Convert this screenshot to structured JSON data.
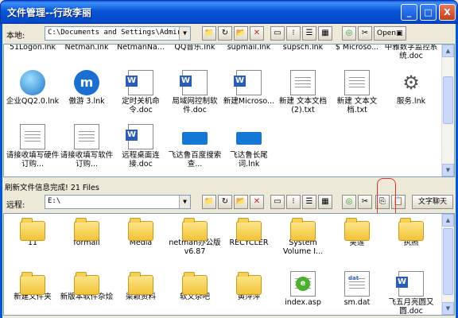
{
  "window": {
    "title": "文件管理--行政李丽",
    "min": "_",
    "max": "□",
    "close": "X"
  },
  "local": {
    "label": "本地:",
    "path": "C:\\Documents and Settings\\Admir",
    "open_label": "Open",
    "top_row": [
      "51Logon.lnk",
      "Netman.lnk",
      "NetmanNa...",
      "QQ音乐.lnk",
      "supmail.lnk",
      "supsch.lnk",
      "$ Microso...",
      "中雅数字监控系统.doc"
    ],
    "row1": [
      {
        "name": "企业QQ2.0.lnk",
        "icon": "qq-icon"
      },
      {
        "name": "傲游 3.lnk",
        "icon": "maxthon-icon"
      },
      {
        "name": "定时关机命令.doc",
        "icon": "word-doc-icon"
      },
      {
        "name": "局域网控制软件.doc",
        "icon": "word-doc-icon"
      },
      {
        "name": "新建Microso...",
        "icon": "word-doc-icon"
      },
      {
        "name": "新建 文本文档 (2).txt",
        "icon": "text-file-icon"
      },
      {
        "name": "新建 文本文档.txt",
        "icon": "text-file-icon"
      },
      {
        "name": "服务.lnk",
        "icon": "gear-service-icon"
      }
    ],
    "row2": [
      {
        "name": "请接收填写硬件订购...",
        "icon": "text-file-icon"
      },
      {
        "name": "请接收填写软件订购...",
        "icon": "text-file-icon"
      },
      {
        "name": "远程桌面连接.doc",
        "icon": "word-doc-icon"
      },
      {
        "name": "飞达鲁百度搜索查...",
        "icon": "blue-tile-icon"
      },
      {
        "name": "飞达鲁长尾词.lnk",
        "icon": "blue-tile-icon"
      }
    ]
  },
  "status": "刷新文件信息完成! 21 Files",
  "remote": {
    "label": "远程:",
    "path": "E:\\",
    "chat_label": "文字聊天",
    "row1": [
      {
        "name": "11",
        "icon": "folder-icon"
      },
      {
        "name": "formail",
        "icon": "folder-icon"
      },
      {
        "name": "Media",
        "icon": "folder-icon"
      },
      {
        "name": "netman办公版 v6.87",
        "icon": "folder-icon"
      },
      {
        "name": "RECYCLER",
        "icon": "folder-icon"
      },
      {
        "name": "System Volume I...",
        "icon": "folder-icon"
      },
      {
        "name": "吴莲",
        "icon": "folder-icon"
      },
      {
        "name": "执照",
        "icon": "folder-icon"
      }
    ],
    "row2": [
      {
        "name": "新建文件夹",
        "icon": "folder-icon"
      },
      {
        "name": "新版本软件杂烩",
        "icon": "folder-icon"
      },
      {
        "name": "梁颖资料",
        "icon": "folder-icon"
      },
      {
        "name": "软文杂吧",
        "icon": "folder-icon"
      },
      {
        "name": "黄萍萍",
        "icon": "folder-icon"
      },
      {
        "name": "index.asp",
        "icon": "asp-file-icon"
      },
      {
        "name": "sm.dat",
        "icon": "dat-file-icon"
      },
      {
        "name": "飞五月亮圆又圆.doc",
        "icon": "word-doc-icon"
      }
    ]
  }
}
